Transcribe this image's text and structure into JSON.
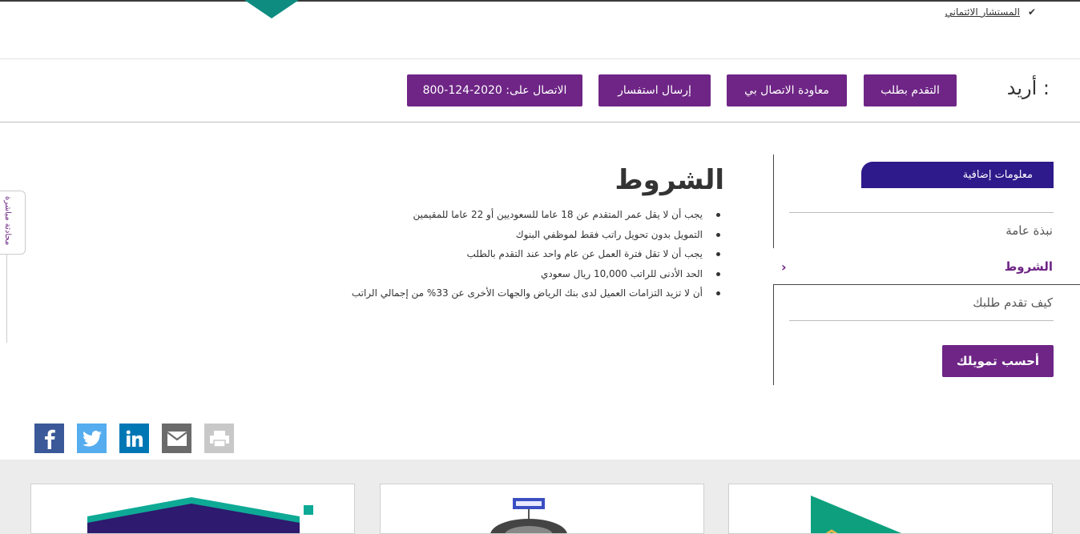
{
  "top": {
    "link_label": "المستشار الائتماني",
    "check_icon": "check-icon"
  },
  "actions": {
    "prefix": "أريد :",
    "buttons": [
      {
        "label": "التقدم بطلب"
      },
      {
        "label": "معاودة الاتصال بي"
      },
      {
        "label": "إرسال استفسار"
      },
      {
        "label": "الاتصال على: 2020-124-800"
      }
    ]
  },
  "side_tab": {
    "label": "محادثة مباشرة"
  },
  "sidebar": {
    "header": "معلومات إضافية",
    "items": [
      {
        "label": "نبذة عامة"
      },
      {
        "label": "الشروط"
      },
      {
        "label": "كيف تقدم طلبك"
      }
    ],
    "calc_button": "أحسب تمويلك"
  },
  "main": {
    "title": "الشروط",
    "conditions": [
      "يجب أن لا يقل عمر المتقدم عن 18 عاما للسعوديين أو 22 عاما للمقيمين",
      "التمويل بدون تحويل راتب فقط لموظفي البنوك",
      "يجب أن لا تقل فترة العمل عن عام واحد عند التقدم بالطلب",
      "الحد الأدنى للراتب 10,000 ريال سعودي",
      "أن لا تزيد التزامات العميل لدى بنك الرياض والجهات الأخرى عن 33% من إجمالي الراتب"
    ]
  },
  "social": [
    {
      "icon": "facebook-icon",
      "color": "#3b5998"
    },
    {
      "icon": "twitter-icon",
      "color": "#55acee"
    },
    {
      "icon": "linkedin-icon",
      "color": "#0077b5"
    },
    {
      "icon": "email-icon",
      "color": "#6b6b6b"
    },
    {
      "icon": "print-icon",
      "color": "#c8c8c8"
    }
  ],
  "colors": {
    "brand_purple": "#6e2585",
    "sidebar_header": "#2e1a8a",
    "teal": "#0e8c80"
  }
}
